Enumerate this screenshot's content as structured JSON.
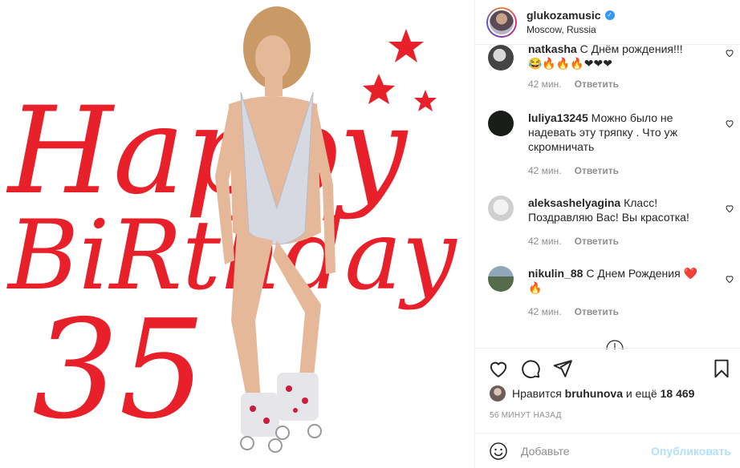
{
  "post": {
    "image_text": {
      "line1": "Happy",
      "line2": "BiRthday",
      "line3": "35"
    }
  },
  "header": {
    "username": "glukozamusic",
    "location": "Moscow, Russia"
  },
  "comments": [
    {
      "username": "natkasha",
      "text": "С Днём рождения!!!",
      "emoji_line": "😂🔥🔥🔥❤❤❤",
      "time": "42 мин.",
      "reply": "Ответить"
    },
    {
      "username": "luliya13245",
      "text": "Можно было не надевать эту тряпку . Что уж скромничать",
      "time": "42 мин.",
      "reply": "Ответить"
    },
    {
      "username": "aleksashelyagina",
      "text": "Класс! Поздравляю Вас! Вы красотка!",
      "time": "42 мин.",
      "reply": "Ответить"
    },
    {
      "username": "nikulin_88",
      "text": "С Днем Рождения ❤️ 🔥",
      "time": "42 мин.",
      "reply": "Ответить"
    }
  ],
  "likes": {
    "prefix": "Нравится",
    "user": "bruhunova",
    "middle": "и ещё",
    "count": "18 469"
  },
  "timestamp": "56 МИНУТ НАЗАД",
  "add_comment": {
    "placeholder": "Добавьте",
    "publish_label": "Опубликовать"
  },
  "colors": {
    "accent_red": "#e8202a",
    "link_blue": "#b2dffc",
    "verified_blue": "#3897f0"
  }
}
